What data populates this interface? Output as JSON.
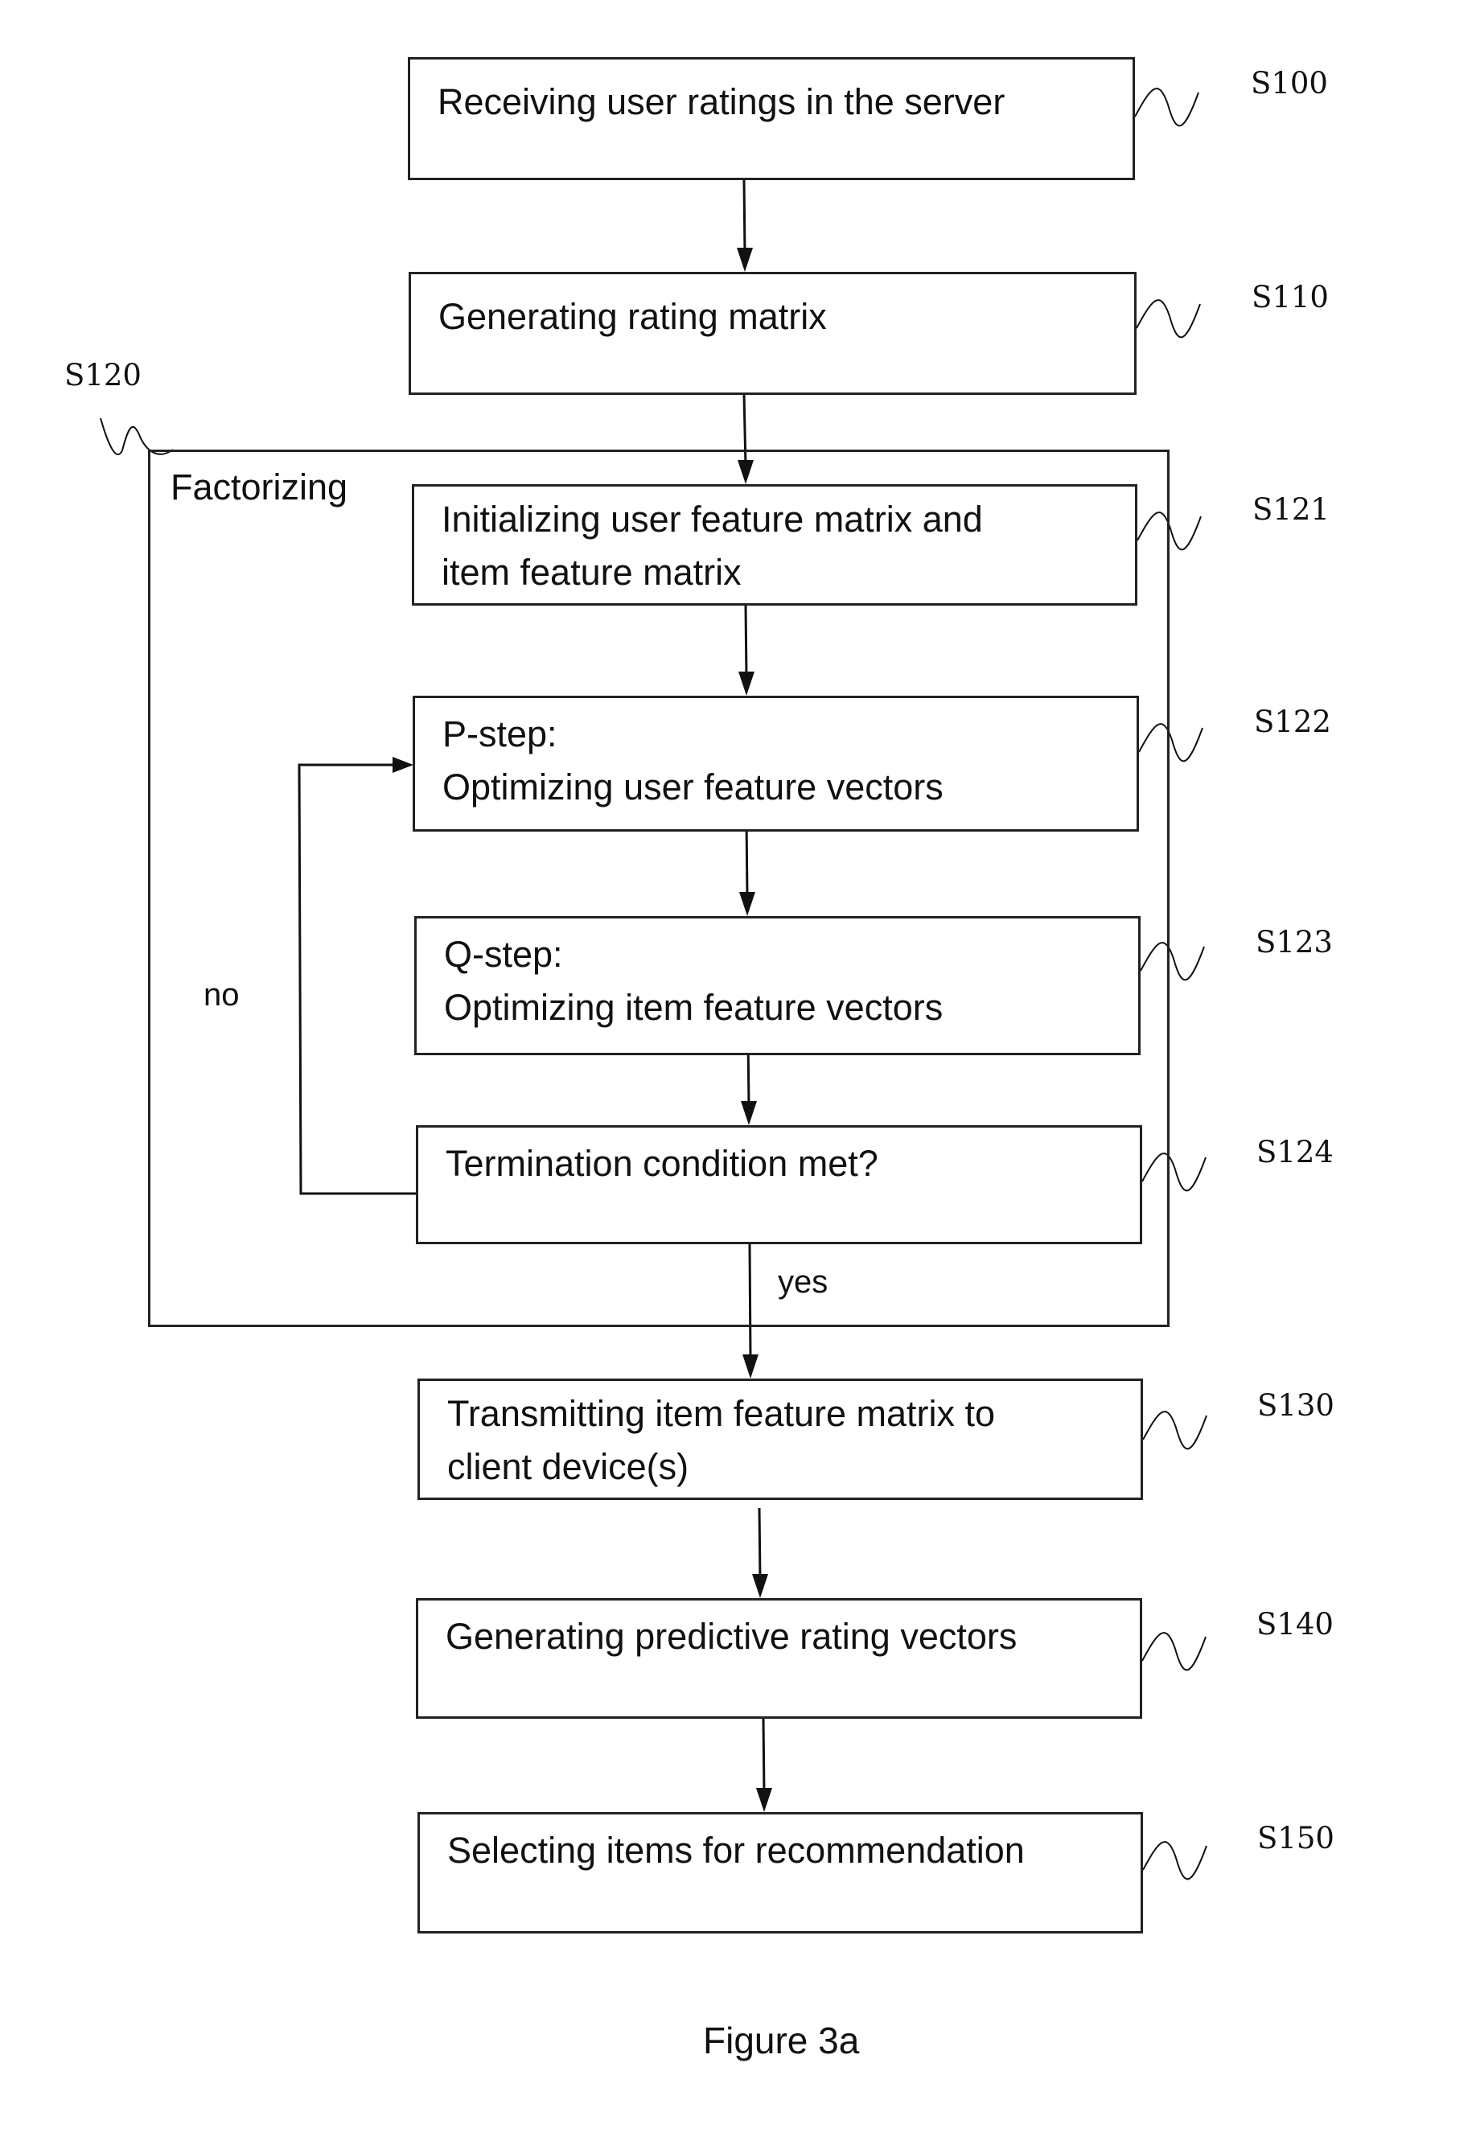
{
  "figure": {
    "caption": "Figure 3a"
  },
  "group": {
    "label": "Factorizing",
    "ref": "S120"
  },
  "steps": [
    {
      "ref": "S100",
      "text": "Receiving user ratings in the server"
    },
    {
      "ref": "S110",
      "text": "Generating rating matrix"
    },
    {
      "ref": "S121",
      "text": "Initializing user feature matrix and\nitem feature matrix"
    },
    {
      "ref": "S122",
      "text": "P-step:\nOptimizing user feature vectors"
    },
    {
      "ref": "S123",
      "text": "Q-step:\nOptimizing item feature vectors"
    },
    {
      "ref": "S124",
      "text": "Termination condition met?"
    },
    {
      "ref": "S130",
      "text": "Transmitting item feature matrix to\nclient device(s)"
    },
    {
      "ref": "S140",
      "text": "Generating predictive rating vectors"
    },
    {
      "ref": "S150",
      "text": "Selecting items for recommendation"
    }
  ],
  "edges": {
    "no_label": "no",
    "yes_label": "yes"
  }
}
